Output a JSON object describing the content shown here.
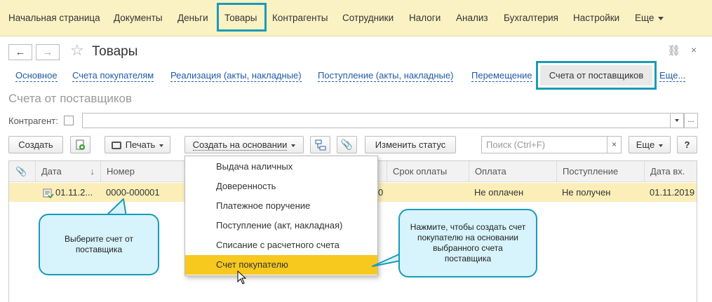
{
  "topnav": {
    "items": [
      "Начальная страница",
      "Документы",
      "Деньги",
      "Товары",
      "Контрагенты",
      "Сотрудники",
      "Налоги",
      "Анализ",
      "Бухгалтерия",
      "Настройки",
      "Еще"
    ]
  },
  "window": {
    "title": "Товары",
    "back_icon": "←",
    "forward_icon": "→",
    "star_icon": "☆",
    "link_icon": "⛓",
    "close_icon": "×"
  },
  "tabs": {
    "items": [
      "Основное",
      "Счета покупателям",
      "Реализация (акты, накладные)",
      "Поступление (акты, накладные)",
      "Перемещение",
      "Счета от поставщиков",
      "Еще..."
    ]
  },
  "section_title": "Счета от поставщиков",
  "filter": {
    "label": "Контрагент:",
    "value": "",
    "select_label": "..."
  },
  "toolbar": {
    "create": "Создать",
    "print": "Печать",
    "create_based": "Создать на основании",
    "change_status": "Изменить статус",
    "search_placeholder": "Поиск (Ctrl+F)",
    "search_clear": "×",
    "more": "Еще",
    "help": "?"
  },
  "table": {
    "columns": [
      "Дата",
      "Номер",
      "Срок оплаты",
      "Оплата",
      "Поступление",
      "Дата вх."
    ],
    "sort_indicator": "↓",
    "row": {
      "date": "01.11.2...",
      "number": "0000-000001",
      "sum_tail": "0",
      "payment": "Не оплачен",
      "receipt": "Не получен",
      "date_in": "01.11.2019"
    }
  },
  "menu": {
    "items": [
      "Выдача наличных",
      "Доверенность",
      "Платежное поручение",
      "Поступление (акт, накладная)",
      "Списание с расчетного счета",
      "Счет покупателю"
    ],
    "selected_index": 5
  },
  "callouts": {
    "left": "Выберите счет от поставщика",
    "right": "Нажмите, чтобы создать счет покупателю на основании выбранного счета поставщика"
  },
  "colors": {
    "accent": "#1a9bb8",
    "topbar_bg": "#fbf2c4",
    "row_highlight": "#fbeeb8",
    "menu_selected": "#f7c81e",
    "callout_bg": "#d7f3fb",
    "link": "#1f5aa6"
  }
}
